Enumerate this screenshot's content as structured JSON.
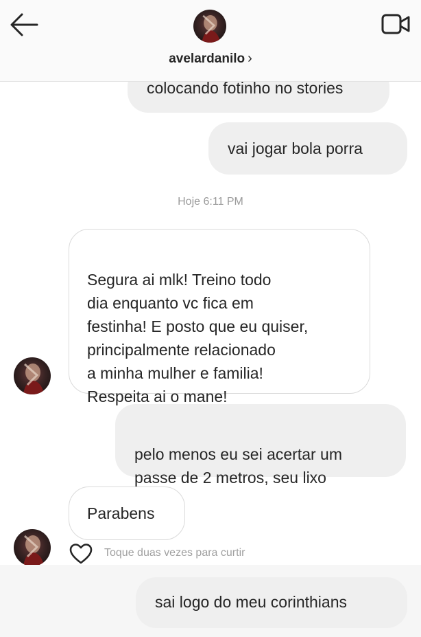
{
  "header": {
    "username": "avelardanilo",
    "chevron": "›",
    "back_icon": "arrow-left-icon",
    "video_icon": "video-camera-icon"
  },
  "messages": [
    {
      "side": "right",
      "text": "colocando fotinho no stories"
    },
    {
      "side": "right",
      "text": "vai jogar bola porra"
    },
    {
      "side": "left",
      "text": "Segura ai mlk! Treino todo\ndia enquanto vc fica em\nfestinha! E posto que eu quiser,\nprincipalmente relacionado\na minha mulher e familia!\nRespeita ai o mane!"
    },
    {
      "side": "right",
      "text": "pelo menos eu sei acertar um\npasse de 2 metros, seu lixo"
    },
    {
      "side": "left",
      "text": "Parabens"
    },
    {
      "side": "right",
      "text": "sai logo do meu corinthians"
    }
  ],
  "timestamp": "Hoje 6:11 PM",
  "like_hint": "Toque duas vezes para curtir",
  "colors": {
    "bubble_gray": "#efefef",
    "bubble_border": "#dadada",
    "header_bg": "#fafafa",
    "meta_text": "#9a9a9a"
  }
}
